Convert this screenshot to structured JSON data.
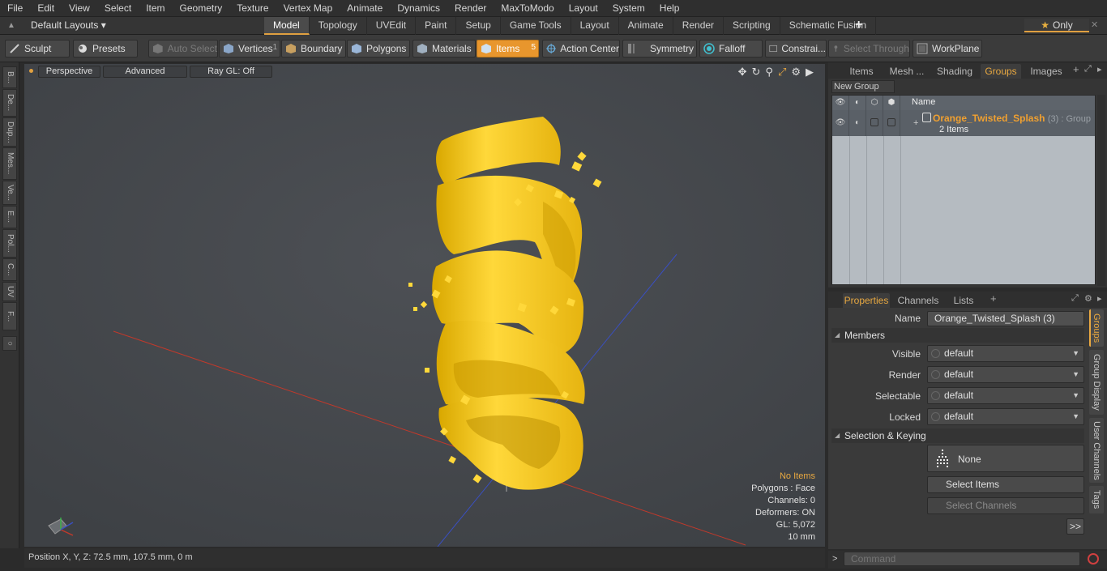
{
  "menubar": {
    "items": [
      "File",
      "Edit",
      "View",
      "Select",
      "Item",
      "Geometry",
      "Texture",
      "Vertex Map",
      "Animate",
      "Dynamics",
      "Render",
      "MaxToModo",
      "Layout",
      "System",
      "Help"
    ]
  },
  "layouts": {
    "label": "Default Layouts ▾",
    "tabs": [
      "Model",
      "Topology",
      "UVEdit",
      "Paint",
      "Setup",
      "Game Tools",
      "Layout",
      "Animate",
      "Render",
      "Scripting",
      "Schematic Fusion"
    ],
    "active_tab": "Model",
    "only_label": "Only"
  },
  "toolbar": {
    "sculpt": "Sculpt",
    "presets": "Presets",
    "auto_select": "Auto Select",
    "vertices": "Vertices",
    "vertices_count": "1",
    "boundary": "Boundary",
    "polygons": "Polygons",
    "materials": "Materials",
    "items": "Items",
    "items_count": "5",
    "action_center": "Action Center",
    "symmetry": "Symmetry",
    "falloff": "Falloff",
    "constraints": "Constrai...",
    "select_through": "Select Through",
    "workplane": "WorkPlane"
  },
  "left_strip": [
    "B...",
    "De...",
    "Dup...",
    "Mes...",
    "Ve...",
    "E...",
    "Pol...",
    "C...",
    "UV",
    "F..."
  ],
  "viewport": {
    "view_mode": "Perspective",
    "shading": "Advanced",
    "raygl": "Ray GL: Off",
    "stats": {
      "selection": "No Items",
      "polygons": "Polygons : Face",
      "channels": "Channels: 0",
      "deformers": "Deformers: ON",
      "gl": "GL: 5,072",
      "scale": "10 mm"
    },
    "model_color": "#f5c518"
  },
  "status": {
    "position": "Position X, Y, Z:   72.5 mm, 107.5 mm, 0 m"
  },
  "right_top": {
    "tabs": [
      "Items",
      "Mesh ...",
      "Shading",
      "Groups",
      "Images"
    ],
    "active_tab": "Groups",
    "new_group": "New Group",
    "column_name": "Name",
    "group": {
      "name": "Orange_Twisted_Splash",
      "suffix": "(3) : Group",
      "count": "2 Items"
    }
  },
  "right_bottom": {
    "tabs": [
      "Properties",
      "Channels",
      "Lists"
    ],
    "active_tab": "Properties",
    "name_label": "Name",
    "name_value": "Orange_Twisted_Splash (3)",
    "members_section": "Members",
    "visible_label": "Visible",
    "visible_value": "default",
    "render_label": "Render",
    "render_value": "default",
    "selectable_label": "Selectable",
    "selectable_value": "default",
    "locked_label": "Locked",
    "locked_value": "default",
    "selkey_section": "Selection & Keying",
    "none_label": "None",
    "select_items": "Select Items",
    "select_channels": "Select Channels",
    "more": ">>",
    "vtabs": [
      "Groups",
      "Group Display",
      "User Channels",
      "Tags"
    ]
  },
  "command": {
    "placeholder": "Command"
  },
  "colors": {
    "accent": "#e8962d",
    "group_name": "#f0a030"
  }
}
